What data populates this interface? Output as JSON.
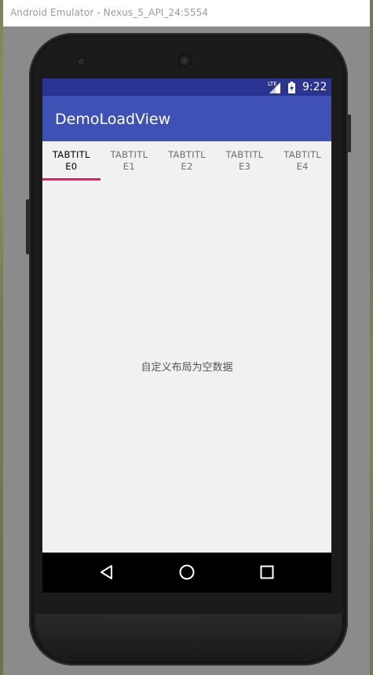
{
  "window": {
    "title": "Android Emulator - Nexus_5_API_24:5554"
  },
  "statusbar": {
    "network_label": "LTE",
    "time": "9:22",
    "colors": {
      "background": "#2a3591"
    }
  },
  "appbar": {
    "title": "DemoLoadView",
    "color": "#3f51b5"
  },
  "tabs": [
    {
      "label": "TABTITL\nE0",
      "active": true
    },
    {
      "label": "TABTITL\nE1",
      "active": false
    },
    {
      "label": "TABTITL\nE2",
      "active": false
    },
    {
      "label": "TABTITL\nE3",
      "active": false
    },
    {
      "label": "TABTITL\nE4",
      "active": false
    }
  ],
  "tab_indicator_color": "#e91e63",
  "content": {
    "empty_message": "自定义布局为空数据"
  },
  "navbar": {
    "icons": [
      "back-icon",
      "home-icon",
      "recents-icon"
    ]
  }
}
